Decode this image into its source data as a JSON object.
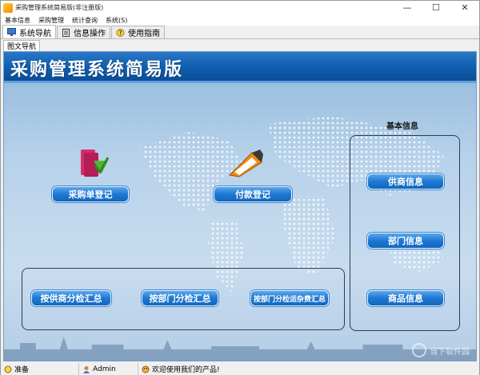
{
  "window": {
    "title": "采购管理系统简易版(非注册版)",
    "controls": {
      "minimize": "—",
      "maximize": "☐",
      "close": "✕"
    }
  },
  "menu": [
    "基本信息",
    "采购管理",
    "统计查询",
    "系统(S)"
  ],
  "tabs": [
    {
      "label": "系统导航",
      "icon": "monitor-icon",
      "active": true
    },
    {
      "label": "信息操作",
      "icon": "form-icon",
      "active": false
    },
    {
      "label": "使用指南",
      "icon": "help-icon",
      "active": false
    }
  ],
  "subtab": {
    "label": "图文导航"
  },
  "banner": {
    "title": "采购管理系统简易版"
  },
  "actions": {
    "purchase_register": "采购单登记",
    "payment_register": "付款登记"
  },
  "summary": {
    "by_supplier": "按供商分检汇总",
    "by_department": "按部门分检汇总",
    "by_department_freight": "按部门分检运杂费汇总"
  },
  "basic_info": {
    "title": "基本信息",
    "supplier": "供商信息",
    "department": "部门信息",
    "goods": "商品信息"
  },
  "watermark": {
    "text": "当下软件园"
  },
  "status": {
    "ready": "准备",
    "user": "Admin",
    "welcome": "欢迎使用我们的产品!"
  },
  "colors": {
    "banner": "#0f5dae",
    "button": "#1e78d2",
    "panel": "#b8d2ea"
  }
}
